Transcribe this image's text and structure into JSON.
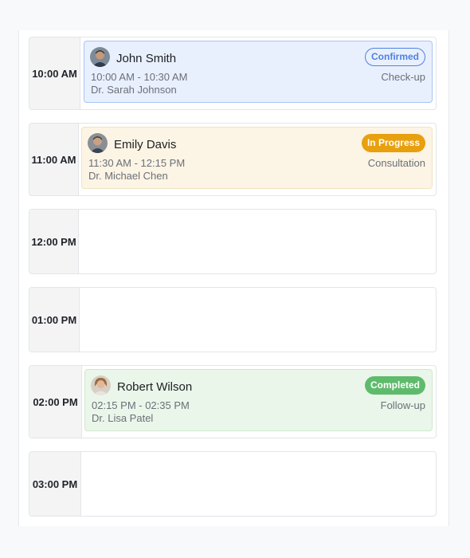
{
  "schedule": {
    "slots": [
      {
        "time": "10:00 AM",
        "appointment": {
          "patient": "John Smith",
          "status": "Confirmed",
          "time_range": "10:00 AM - 10:30 AM",
          "type": "Check-up",
          "doctor": "Dr. Sarah Johnson",
          "status_color": "#4f82e0",
          "card_color": "#e9f0fd"
        }
      },
      {
        "time": "11:00 AM",
        "appointment": {
          "patient": "Emily Davis",
          "status": "In Progress",
          "time_range": "11:30 AM - 12:15 PM",
          "type": "Consultation",
          "doctor": "Dr. Michael Chen",
          "status_color": "#e8a00e",
          "card_color": "#fcf4e4"
        }
      },
      {
        "time": "12:00 PM"
      },
      {
        "time": "01:00 PM"
      },
      {
        "time": "02:00 PM",
        "appointment": {
          "patient": "Robert Wilson",
          "status": "Completed",
          "time_range": "02:15 PM - 02:35 PM",
          "type": "Follow-up",
          "doctor": "Dr. Lisa Patel",
          "status_color": "#5fbb6c",
          "card_color": "#eaf6ea"
        }
      },
      {
        "time": "03:00 PM"
      }
    ]
  }
}
